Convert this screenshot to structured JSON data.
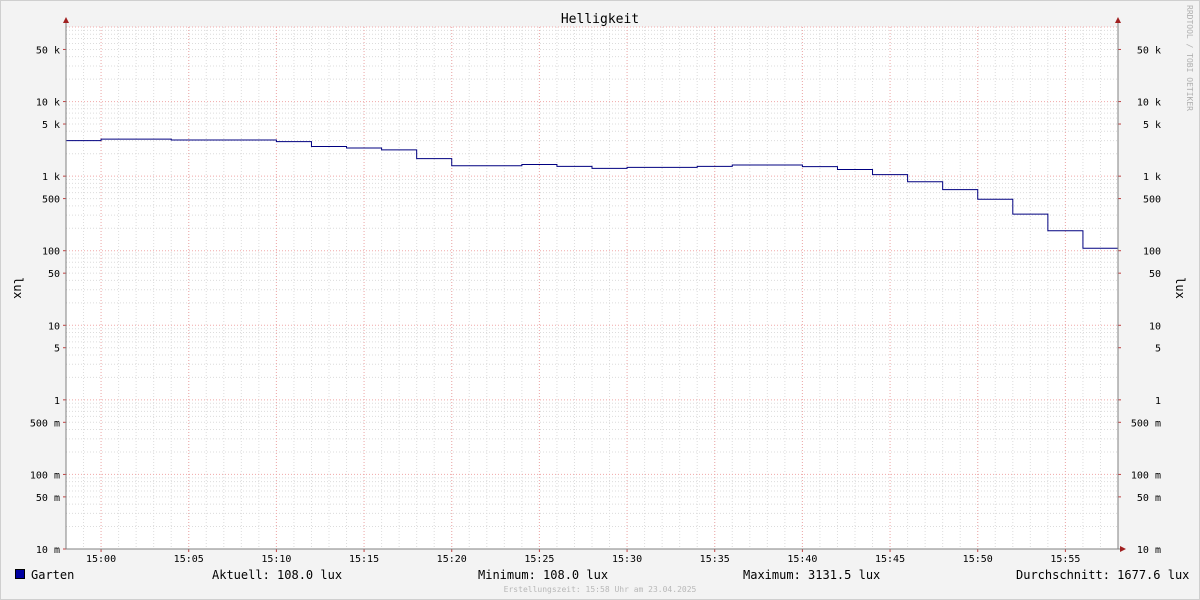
{
  "chart_data": {
    "type": "line",
    "title": "Helligkeit",
    "ylabel": "lux",
    "yscale": "log",
    "ylim": [
      0.01,
      100000
    ],
    "xlim": [
      "14:58",
      "15:58"
    ],
    "grid": true,
    "x_ticks": [
      "15:00",
      "15:05",
      "15:10",
      "15:15",
      "15:20",
      "15:25",
      "15:30",
      "15:35",
      "15:40",
      "15:45",
      "15:50",
      "15:55"
    ],
    "y_ticks": [
      {
        "value": 50000,
        "label": "50 k"
      },
      {
        "value": 10000,
        "label": "10 k"
      },
      {
        "value": 5000,
        "label": "5 k"
      },
      {
        "value": 1000,
        "label": "1 k"
      },
      {
        "value": 500,
        "label": "500"
      },
      {
        "value": 100,
        "label": "100"
      },
      {
        "value": 50,
        "label": "50"
      },
      {
        "value": 10,
        "label": "10"
      },
      {
        "value": 5,
        "label": "5"
      },
      {
        "value": 1,
        "label": "1"
      },
      {
        "value": 0.5,
        "label": "500 m"
      },
      {
        "value": 0.1,
        "label": "100 m"
      },
      {
        "value": 0.05,
        "label": "50 m"
      },
      {
        "value": 0.01,
        "label": "10 m"
      }
    ],
    "series": [
      {
        "name": "Garten",
        "color": "#000080",
        "steps": [
          {
            "t": "14:58",
            "v": 3000
          },
          {
            "t": "15:00",
            "v": 3131.5
          },
          {
            "t": "15:04",
            "v": 3050
          },
          {
            "t": "15:10",
            "v": 2900
          },
          {
            "t": "15:12",
            "v": 2500
          },
          {
            "t": "15:14",
            "v": 2380
          },
          {
            "t": "15:16",
            "v": 2250
          },
          {
            "t": "15:18",
            "v": 1720
          },
          {
            "t": "15:20",
            "v": 1380
          },
          {
            "t": "15:24",
            "v": 1430
          },
          {
            "t": "15:26",
            "v": 1350
          },
          {
            "t": "15:28",
            "v": 1270
          },
          {
            "t": "15:30",
            "v": 1310
          },
          {
            "t": "15:34",
            "v": 1350
          },
          {
            "t": "15:36",
            "v": 1410
          },
          {
            "t": "15:40",
            "v": 1340
          },
          {
            "t": "15:42",
            "v": 1230
          },
          {
            "t": "15:44",
            "v": 1050
          },
          {
            "t": "15:46",
            "v": 840
          },
          {
            "t": "15:48",
            "v": 660
          },
          {
            "t": "15:50",
            "v": 490
          },
          {
            "t": "15:52",
            "v": 310
          },
          {
            "t": "15:54",
            "v": 185
          },
          {
            "t": "15:56",
            "v": 108
          },
          {
            "t": "15:58",
            "v": 108
          }
        ]
      }
    ]
  },
  "legend": {
    "series_name": "Garten",
    "swatch_color": "#0000a0",
    "current": "Aktuell: 108.0 lux",
    "minimum": "Minimum: 108.0 lux",
    "maximum": "Maximum: 3131.5 lux",
    "average": "Durchschnitt: 1677.6 lux"
  },
  "watermark": "RRDTOOL / TOBI OETIKER",
  "footer": "Erstellungszeit: 15:58 Uhr am 23.04.2025"
}
